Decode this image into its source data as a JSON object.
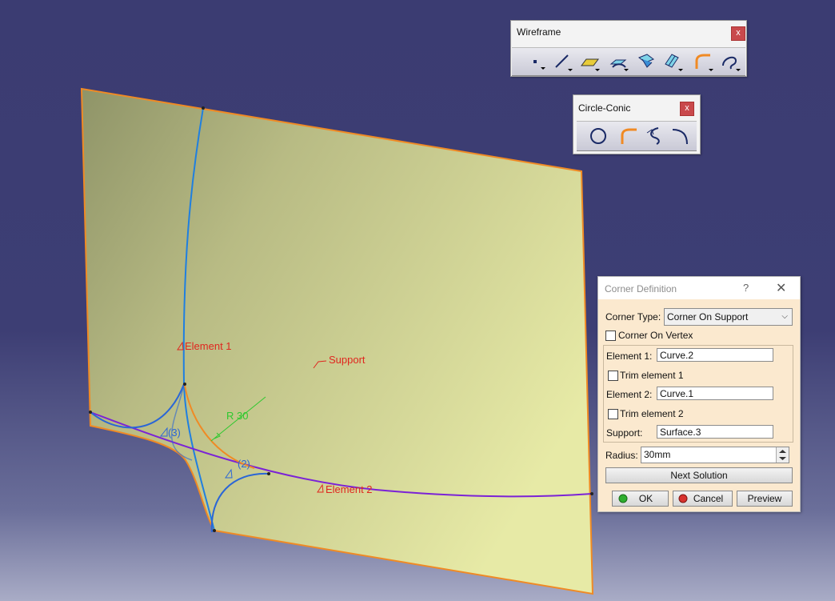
{
  "viewport": {
    "labels": {
      "element1": "Element 1",
      "element2": "Element 2",
      "support": "Support",
      "radius": "R 30",
      "sol2": "(2)",
      "sol3": "(3)"
    },
    "colors": {
      "surface": "#c9cb8a",
      "edge": "#f08a24",
      "curve1": "#7b22d6",
      "curve2": "#1f7fe0",
      "solutions": "#2a66d6",
      "corner": "#f08a24",
      "label": "#e0261f",
      "radius_label": "#2fc82f"
    }
  },
  "wireframe_toolbar": {
    "title": "Wireframe",
    "close": "x",
    "icons": [
      "point-icon",
      "line-icon",
      "plane-icon",
      "projection-icon",
      "intersection-icon",
      "offset-icon",
      "corner-icon",
      "spline-icon"
    ]
  },
  "circle_conic_toolbar": {
    "title": "Circle-Conic",
    "close": "x",
    "icons": [
      "circle-icon",
      "corner-icon",
      "connect-curve-icon",
      "conic-icon"
    ]
  },
  "dialog": {
    "title": "Corner Definition",
    "help": "?",
    "close": "✕",
    "corner_type_label": "Corner Type:",
    "corner_type_value": "Corner On Support",
    "corner_on_vertex_label": "Corner On Vertex",
    "element1_label": "Element 1:",
    "element1_value": "Curve.2",
    "trim1_label": "Trim element 1",
    "element2_label": "Element 2:",
    "element2_value": "Curve.1",
    "trim2_label": "Trim element 2",
    "support_label": "Support:",
    "support_value": "Surface.3",
    "radius_label": "Radius:",
    "radius_value": "30mm",
    "next_solution": "Next Solution",
    "ok": "OK",
    "cancel": "Cancel",
    "preview": "Preview"
  }
}
